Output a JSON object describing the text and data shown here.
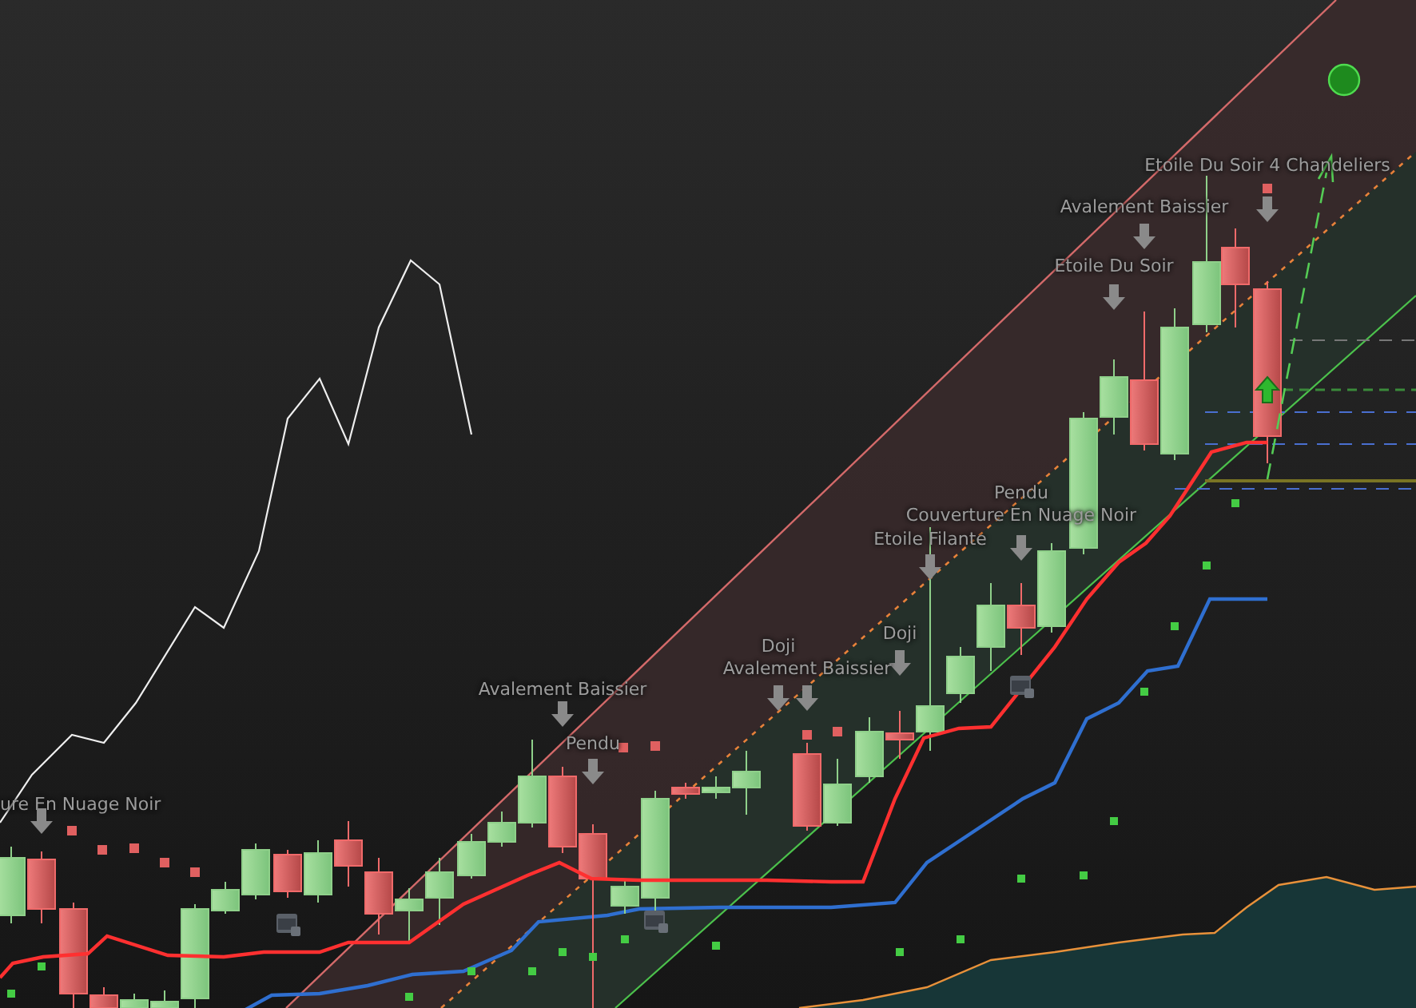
{
  "chart": {
    "pattern_labels": [
      {
        "label": "Etoile Du Soir 4 Chandeliers"
      },
      {
        "label": "Avalement Baissier"
      },
      {
        "label": "Etoile Du Soir"
      },
      {
        "label": "Pendu"
      },
      {
        "label": "Couverture En Nuage Noir"
      },
      {
        "label": "Etoile Filante"
      },
      {
        "label": "Doji"
      },
      {
        "label": "Doji"
      },
      {
        "label": "Avalement Baissier"
      },
      {
        "label": "Avalement Baissier"
      },
      {
        "label": "Pendu"
      },
      {
        "label": "ure En Nuage Noir"
      }
    ]
  }
}
